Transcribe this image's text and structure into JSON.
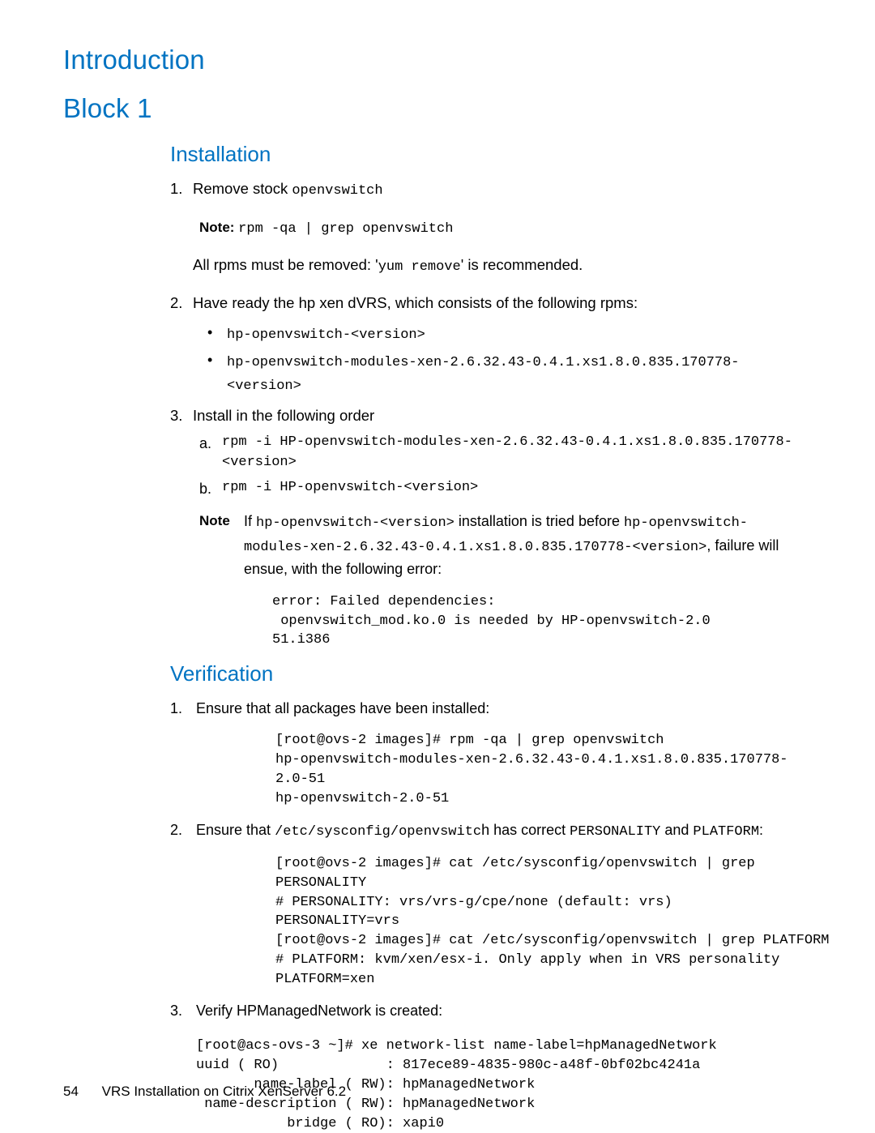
{
  "headings": {
    "intro": "Introduction",
    "block1": "Block 1",
    "installation": "Installation",
    "verification": "Verification"
  },
  "installation": {
    "step1_prefix": "Remove stock ",
    "step1_code": "openvswitch",
    "note1_label": "Note",
    "note1_sep": ": ",
    "note1_code": "rpm -qa | grep openvswitch",
    "step1_body_a": "All rpms must be removed: '",
    "step1_body_code": "yum remove",
    "step1_body_b": "' is recommended.",
    "step2_text": "Have ready the hp xen dVRS, which consists of the following rpms:",
    "bullets": [
      "hp-openvswitch-<version>",
      "hp-openvswitch-modules-xen-2.6.32.43-0.4.1.xs1.8.0.835.170778-<version>"
    ],
    "step3_text": "Install in the following order",
    "alpha": [
      "rpm -i HP-openvswitch-modules-xen-2.6.32.43-0.4.1.xs1.8.0.835.170778-<version>",
      "rpm -i HP-openvswitch-<version>"
    ],
    "note2_label": "Note",
    "note2_a": "If ",
    "note2_code1": "hp-openvswitch-<version>",
    "note2_b": " installation is tried before ",
    "note2_code2": "hp-openvswitch-modules-xen-2.6.32.43-0.4.1.xs1.8.0.835.170778-<version>",
    "note2_c": ", failure will ensue, with the following error:",
    "error_block": "error: Failed dependencies:\n openvswitch_mod.ko.0 is needed by HP-openvswitch-2.0\n51.i386"
  },
  "verification": {
    "step1": "Ensure that all packages have been installed:",
    "code1": "[root@ovs-2 images]# rpm -qa | grep openvswitch\nhp-openvswitch-modules-xen-2.6.32.43-0.4.1.xs1.8.0.835.170778-\n2.0-51\nhp-openvswitch-2.0-51",
    "step2_a": "Ensure that ",
    "step2_code1": "/etc/sysconfig/openvswitc",
    "step2_b": "h has correct ",
    "step2_code2": "PERSONALITY",
    "step2_c": " and ",
    "step2_code3": "PLATFORM",
    "step2_d": ":",
    "code2": "[root@ovs-2 images]# cat /etc/sysconfig/openvswitch | grep\nPERSONALITY\n# PERSONALITY: vrs/vrs-g/cpe/none (default: vrs)\nPERSONALITY=vrs\n[root@ovs-2 images]# cat /etc/sysconfig/openvswitch | grep PLATFORM\n# PLATFORM: kvm/xen/esx-i. Only apply when in VRS personality\nPLATFORM=xen",
    "step3": "Verify HPManagedNetwork is created:",
    "code3": "[root@acs-ovs-3 ~]# xe network-list name-label=hpManagedNetwork\nuuid ( RO)             : 817ece89-4835-980c-a48f-0bf02bc4241a\n       name-label ( RW): hpManagedNetwork\n name-description ( RW): hpManagedNetwork\n           bridge ( RO): xapi0"
  },
  "footer": {
    "page": "54",
    "title": "VRS Installation on Citrix XenServer 6.2"
  }
}
